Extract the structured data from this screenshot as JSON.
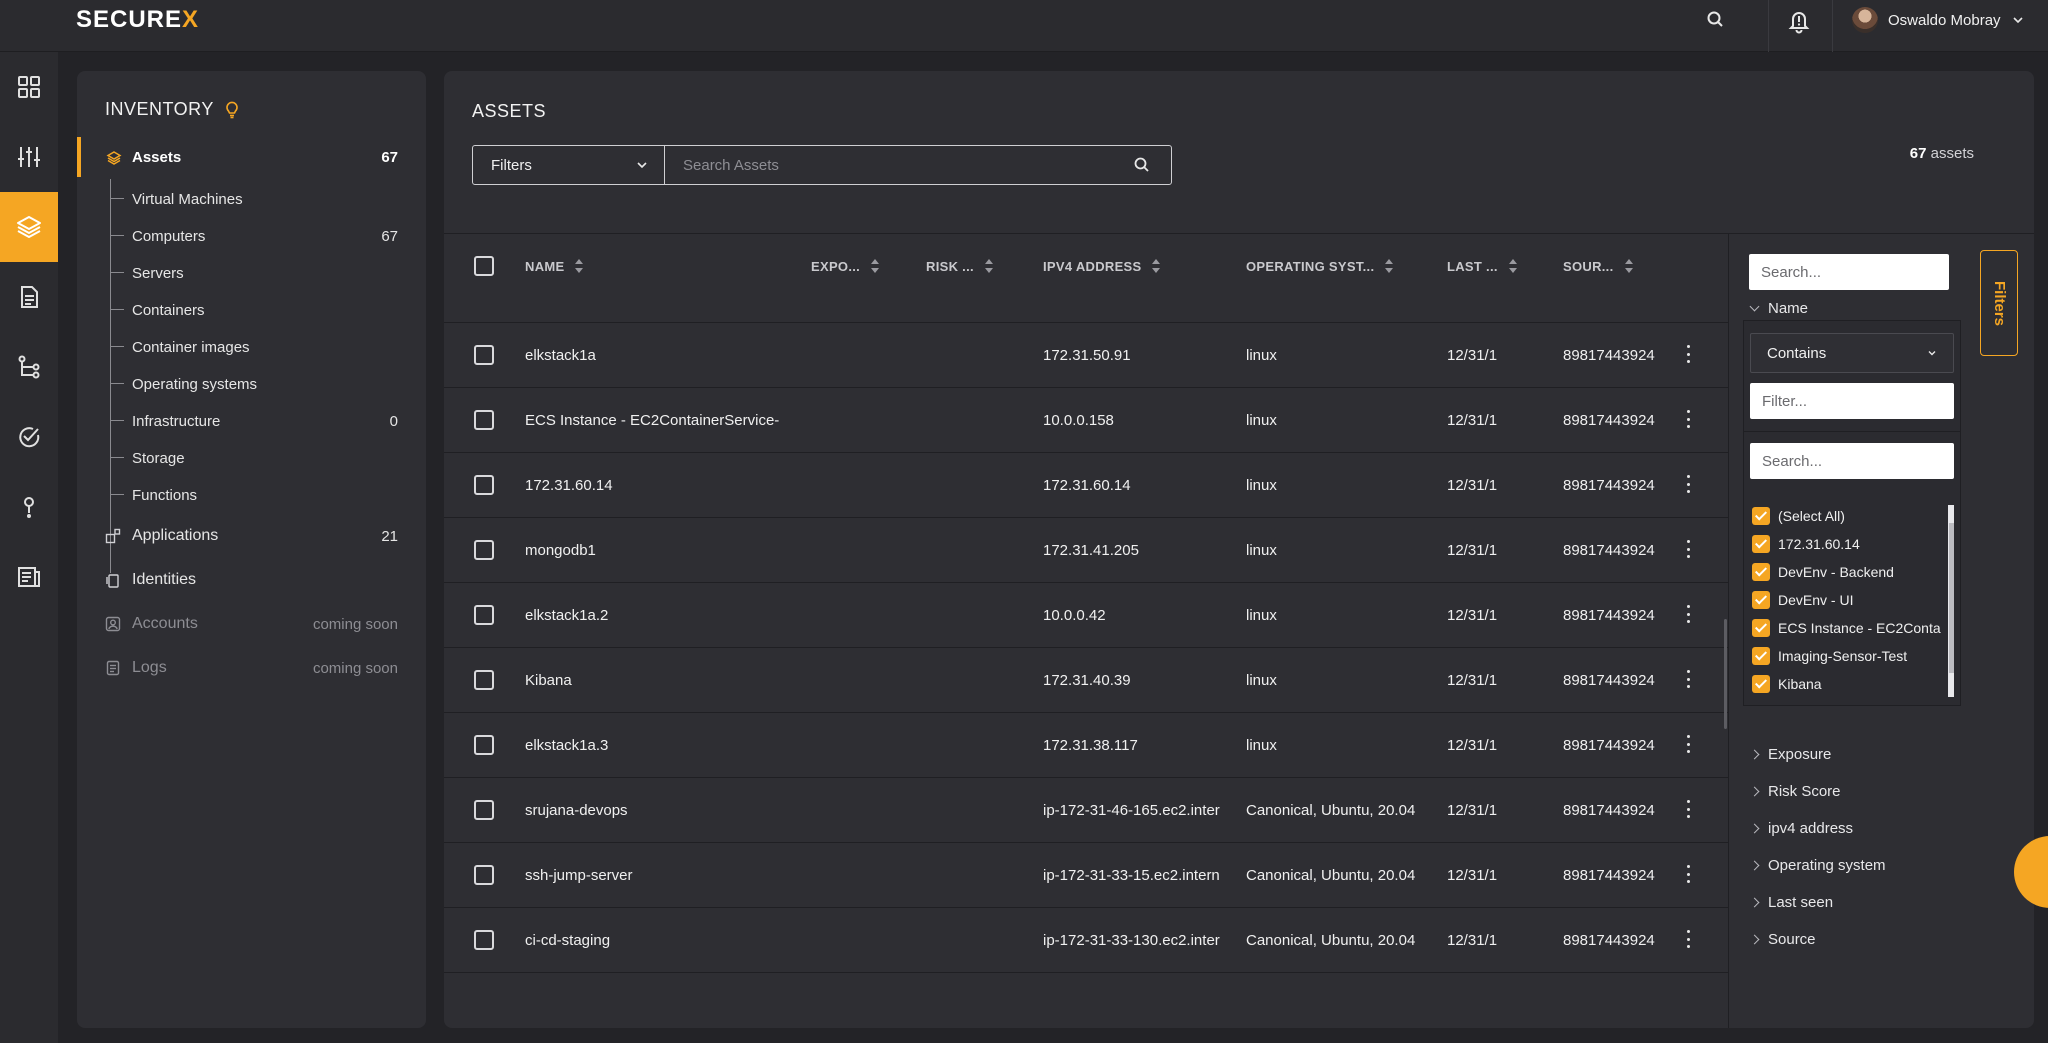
{
  "app": {
    "logo_main": "SECURE",
    "logo_accent": "X"
  },
  "user": {
    "name": "Oswaldo Mobray"
  },
  "inventory": {
    "title": "INVENTORY",
    "assets": {
      "label": "Assets",
      "count": "67"
    },
    "children": [
      {
        "label": "Virtual Machines",
        "count": ""
      },
      {
        "label": "Computers",
        "count": "67"
      },
      {
        "label": "Servers",
        "count": ""
      },
      {
        "label": "Containers",
        "count": ""
      },
      {
        "label": "Container images",
        "count": ""
      },
      {
        "label": "Operating systems",
        "count": ""
      },
      {
        "label": "Infrastructure",
        "count": "0"
      },
      {
        "label": "Storage",
        "count": ""
      },
      {
        "label": "Functions",
        "count": ""
      }
    ],
    "applications": {
      "label": "Applications",
      "count": "21"
    },
    "identities": {
      "label": "Identities"
    },
    "accounts": {
      "label": "Accounts",
      "note": "coming soon"
    },
    "logs": {
      "label": "Logs",
      "note": "coming soon"
    }
  },
  "main": {
    "title": "ASSETS",
    "filter_dropdown": "Filters",
    "search_placeholder": "Search Assets",
    "count_value": "67",
    "count_label": "assets"
  },
  "table": {
    "columns": [
      "NAME",
      "EXPO...",
      "RISK ...",
      "IPV4 ADDRESS",
      "OPERATING SYST...",
      "LAST ...",
      "SOUR..."
    ],
    "rows": [
      {
        "name": "elkstack1a",
        "ip": "172.31.50.91",
        "os": "linux",
        "last": "12/31/1",
        "source": "89817443924"
      },
      {
        "name": "ECS Instance - EC2ContainerService-",
        "ip": "10.0.0.158",
        "os": "linux",
        "last": "12/31/1",
        "source": "89817443924"
      },
      {
        "name": "172.31.60.14",
        "ip": "172.31.60.14",
        "os": "linux",
        "last": "12/31/1",
        "source": "89817443924"
      },
      {
        "name": "mongodb1",
        "ip": "172.31.41.205",
        "os": "linux",
        "last": "12/31/1",
        "source": "89817443924"
      },
      {
        "name": "elkstack1a.2",
        "ip": "10.0.0.42",
        "os": "linux",
        "last": "12/31/1",
        "source": "89817443924"
      },
      {
        "name": "Kibana",
        "ip": "172.31.40.39",
        "os": "linux",
        "last": "12/31/1",
        "source": "89817443924"
      },
      {
        "name": "elkstack1a.3",
        "ip": "172.31.38.117",
        "os": "linux",
        "last": "12/31/1",
        "source": "89817443924"
      },
      {
        "name": "srujana-devops",
        "ip": "ip-172-31-46-165.ec2.inter",
        "os": "Canonical, Ubuntu, 20.04",
        "last": "12/31/1",
        "source": "89817443924"
      },
      {
        "name": "ssh-jump-server",
        "ip": "ip-172-31-33-15.ec2.intern",
        "os": "Canonical, Ubuntu, 20.04",
        "last": "12/31/1",
        "source": "89817443924"
      },
      {
        "name": "ci-cd-staging",
        "ip": "ip-172-31-33-130.ec2.inter",
        "os": "Canonical, Ubuntu, 20.04",
        "last": "12/31/1",
        "source": "89817443924"
      }
    ]
  },
  "side_filter": {
    "search_placeholder": "Search...",
    "name_label": "Name",
    "operator": "Contains",
    "filter_placeholder": "Filter...",
    "values_search_placeholder": "Search...",
    "values": [
      "(Select All)",
      "172.31.60.14",
      "DevEnv - Backend",
      "DevEnv - UI",
      "ECS Instance - EC2Conta",
      "Imaging-Sensor-Test",
      "Kibana"
    ],
    "sections": [
      "Exposure",
      "Risk Score",
      "ipv4 address",
      "Operating system",
      "Last seen",
      "Source"
    ],
    "tab_label": "Filters"
  },
  "colors": {
    "accent": "#f5a623",
    "background": "#232327",
    "panel": "#2e2e33"
  }
}
